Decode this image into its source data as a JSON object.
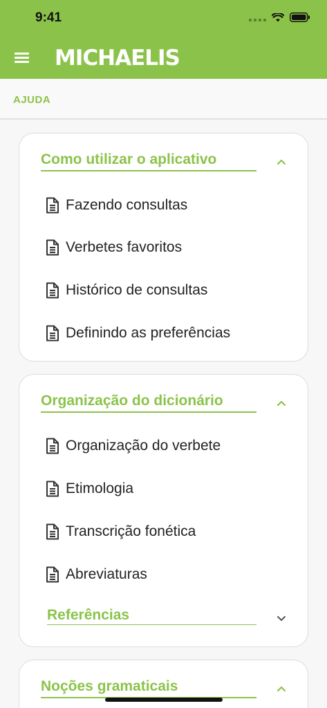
{
  "status": {
    "time": "9:41"
  },
  "appbar": {
    "logo": "MICHAELIS"
  },
  "section": {
    "label": "AJUDA"
  },
  "cards": [
    {
      "title": "Como utilizar o aplicativo",
      "items": [
        "Fazendo consultas",
        "Verbetes favoritos",
        "Histórico de consultas",
        "Definindo as preferências"
      ]
    },
    {
      "title": "Organização do dicionário",
      "items": [
        "Organização do verbete",
        "Etimologia",
        "Transcrição fonética",
        "Abreviaturas"
      ],
      "sub": {
        "title": "Referências"
      }
    },
    {
      "title": "Noções gramaticais"
    }
  ],
  "colors": {
    "accent": "#8bc34a",
    "text": "#222222"
  },
  "icons": {
    "item": "document-icon",
    "expanded": "chevron-up-icon",
    "collapsed": "chevron-down-icon"
  }
}
